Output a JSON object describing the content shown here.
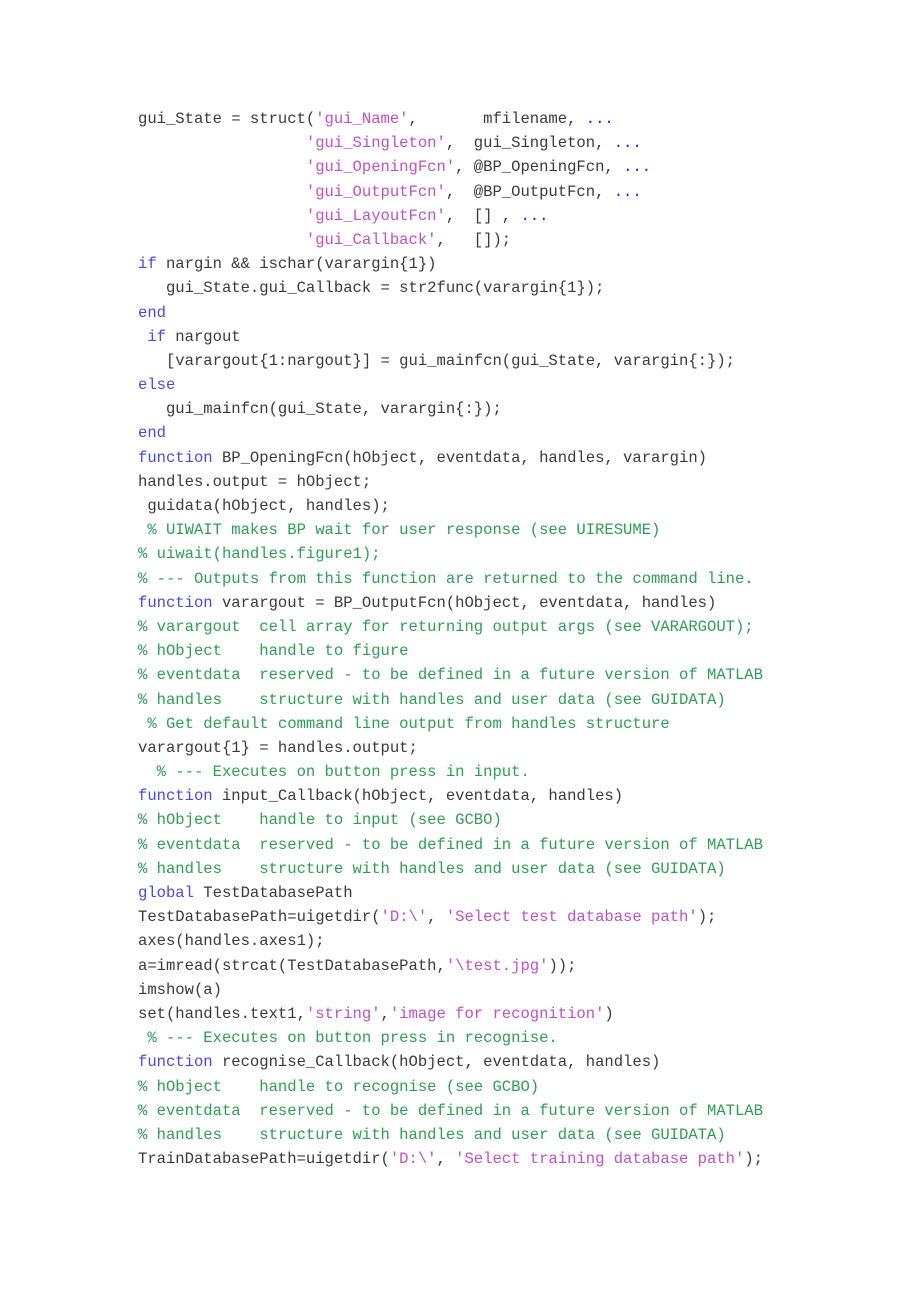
{
  "document": {
    "type": "matlab-source-listing",
    "language": "MATLAB",
    "page_background": "#ffffff",
    "colors": {
      "plain": "#3a3a3a",
      "keyword": "#4a4ae0",
      "comment": "#2e9e55",
      "string": "#c050c8",
      "continuation": "#2222ee"
    }
  },
  "code": {
    "lines": [
      [
        {
          "t": "gui_State = struct(",
          "c": "plain"
        },
        {
          "t": "'gui_Name'",
          "c": "string"
        },
        {
          "t": ",       mfilename, ",
          "c": "plain"
        },
        {
          "t": "...",
          "c": "cont"
        }
      ],
      [
        {
          "t": "                  ",
          "c": "plain"
        },
        {
          "t": "'gui_Singleton'",
          "c": "string"
        },
        {
          "t": ",  gui_Singleton, ",
          "c": "plain"
        },
        {
          "t": "...",
          "c": "cont"
        }
      ],
      [
        {
          "t": "                  ",
          "c": "plain"
        },
        {
          "t": "'gui_OpeningFcn'",
          "c": "string"
        },
        {
          "t": ", @BP_OpeningFcn, ",
          "c": "plain"
        },
        {
          "t": "...",
          "c": "cont"
        }
      ],
      [
        {
          "t": "                  ",
          "c": "plain"
        },
        {
          "t": "'gui_OutputFcn'",
          "c": "string"
        },
        {
          "t": ",  @BP_OutputFcn, ",
          "c": "plain"
        },
        {
          "t": "...",
          "c": "cont"
        }
      ],
      [
        {
          "t": "                  ",
          "c": "plain"
        },
        {
          "t": "'gui_LayoutFcn'",
          "c": "string"
        },
        {
          "t": ",  [] , ",
          "c": "plain"
        },
        {
          "t": "...",
          "c": "cont"
        }
      ],
      [
        {
          "t": "                  ",
          "c": "plain"
        },
        {
          "t": "'gui_Callback'",
          "c": "string"
        },
        {
          "t": ",   []);",
          "c": "plain"
        }
      ],
      [
        {
          "t": "if",
          "c": "keyword"
        },
        {
          "t": " nargin && ischar(varargin{1})",
          "c": "plain"
        }
      ],
      [
        {
          "t": "   gui_State.gui_Callback = str2func(varargin{1});",
          "c": "plain"
        }
      ],
      [
        {
          "t": "end",
          "c": "keyword"
        }
      ],
      [
        {
          "t": " ",
          "c": "plain"
        },
        {
          "t": "if",
          "c": "keyword"
        },
        {
          "t": " nargout",
          "c": "plain"
        }
      ],
      [
        {
          "t": "   [varargout{1:nargout}] = gui_mainfcn(gui_State, varargin{:});",
          "c": "plain"
        }
      ],
      [
        {
          "t": "else",
          "c": "keyword"
        }
      ],
      [
        {
          "t": "   gui_mainfcn(gui_State, varargin{:});",
          "c": "plain"
        }
      ],
      [
        {
          "t": "end",
          "c": "keyword"
        }
      ],
      [
        {
          "t": "function",
          "c": "keyword"
        },
        {
          "t": " BP_OpeningFcn(hObject, eventdata, handles, varargin)",
          "c": "plain"
        }
      ],
      [
        {
          "t": "handles.output = hObject;",
          "c": "plain"
        }
      ],
      [
        {
          "t": " guidata(hObject, handles);",
          "c": "plain"
        }
      ],
      [
        {
          "t": " % UIWAIT makes BP wait for user response (see UIRESUME)",
          "c": "comment"
        }
      ],
      [
        {
          "t": "% uiwait(handles.figure1);",
          "c": "comment"
        }
      ],
      [
        {
          "t": "% --- Outputs from this function are returned to the command line.",
          "c": "comment"
        }
      ],
      [
        {
          "t": "function",
          "c": "keyword"
        },
        {
          "t": " varargout = BP_OutputFcn(hObject, eventdata, handles)",
          "c": "plain"
        }
      ],
      [
        {
          "t": "% varargout  cell array for returning output args (see VARARGOUT);",
          "c": "comment"
        }
      ],
      [
        {
          "t": "% hObject    handle to figure",
          "c": "comment"
        }
      ],
      [
        {
          "t": "% eventdata  reserved - to be defined in a future version of MATLAB",
          "c": "comment"
        }
      ],
      [
        {
          "t": "% handles    structure with handles and user data (see GUIDATA)",
          "c": "comment"
        }
      ],
      [
        {
          "t": " % Get default command line output from handles structure",
          "c": "comment"
        }
      ],
      [
        {
          "t": "varargout{1} = handles.output;",
          "c": "plain"
        }
      ],
      [
        {
          "t": "  % --- Executes on button press in input.",
          "c": "comment"
        }
      ],
      [
        {
          "t": "function",
          "c": "keyword"
        },
        {
          "t": " input_Callback(hObject, eventdata, handles)",
          "c": "plain"
        }
      ],
      [
        {
          "t": "% hObject    handle to input (see GCBO)",
          "c": "comment"
        }
      ],
      [
        {
          "t": "% eventdata  reserved - to be defined in a future version of MATLAB",
          "c": "comment"
        }
      ],
      [
        {
          "t": "% handles    structure with handles and user data (see GUIDATA)",
          "c": "comment"
        }
      ],
      [
        {
          "t": "global",
          "c": "keyword"
        },
        {
          "t": " TestDatabasePath",
          "c": "plain"
        }
      ],
      [
        {
          "t": "TestDatabasePath=uigetdir(",
          "c": "plain"
        },
        {
          "t": "'D:\\'",
          "c": "string"
        },
        {
          "t": ", ",
          "c": "plain"
        },
        {
          "t": "'Select test database path'",
          "c": "string"
        },
        {
          "t": ");",
          "c": "plain"
        }
      ],
      [
        {
          "t": "axes(handles.axes1);",
          "c": "plain"
        }
      ],
      [
        {
          "t": "a=imread(strcat(TestDatabasePath,",
          "c": "plain"
        },
        {
          "t": "'\\test.jpg'",
          "c": "string"
        },
        {
          "t": "));",
          "c": "plain"
        }
      ],
      [
        {
          "t": "imshow(a)",
          "c": "plain"
        }
      ],
      [
        {
          "t": "set(handles.text1,",
          "c": "plain"
        },
        {
          "t": "'string'",
          "c": "string"
        },
        {
          "t": ",",
          "c": "plain"
        },
        {
          "t": "'image for recognition'",
          "c": "string"
        },
        {
          "t": ")",
          "c": "plain"
        }
      ],
      [
        {
          "t": " % --- Executes on button press in recognise.",
          "c": "comment"
        }
      ],
      [
        {
          "t": "function",
          "c": "keyword"
        },
        {
          "t": " recognise_Callback(hObject, eventdata, handles)",
          "c": "plain"
        }
      ],
      [
        {
          "t": "% hObject    handle to recognise (see GCBO)",
          "c": "comment"
        }
      ],
      [
        {
          "t": "% eventdata  reserved - to be defined in a future version of MATLAB",
          "c": "comment"
        }
      ],
      [
        {
          "t": "% handles    structure with handles and user data (see GUIDATA)",
          "c": "comment"
        }
      ],
      [
        {
          "t": "TrainDatabasePath=uigetdir(",
          "c": "plain"
        },
        {
          "t": "'D:\\'",
          "c": "string"
        },
        {
          "t": ", ",
          "c": "plain"
        },
        {
          "t": "'Select training database path'",
          "c": "string"
        },
        {
          "t": ");",
          "c": "plain"
        }
      ]
    ]
  }
}
